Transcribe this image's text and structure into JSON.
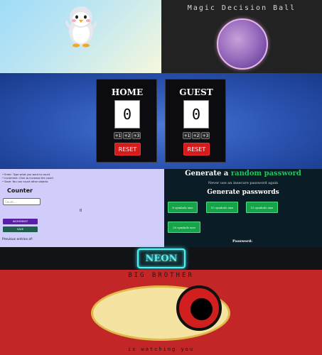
{
  "magic": {
    "title": "Magic Decision Ball"
  },
  "scoreboard": {
    "home": {
      "name": "HOME",
      "score": "0"
    },
    "guest": {
      "name": "GUEST",
      "score": "0"
    },
    "increments": [
      "+1",
      "+2",
      "+3"
    ],
    "reset_label": "RESET",
    "colors": {
      "reset": "#d41c1c",
      "panel": "#0c0c10"
    }
  },
  "counter": {
    "instructions": [
      "Enter: Type what you want to count",
      "Increment: Click to increase the count",
      "Save: You can count other objects"
    ],
    "title": "Counter",
    "input_placeholder": "Count...",
    "value": "0",
    "increment_label": "INCREMENT",
    "save_label": "SAVE",
    "previous_label": "Previous entries of:"
  },
  "password": {
    "title_prefix": "Generate a",
    "title_accent": "random password",
    "subtitle": "Never use an insecure password again",
    "heading": "Generate passwords",
    "buttons": [
      "8 symbols size",
      "10 symbols size",
      "15 symbols size",
      "20 symbols size"
    ],
    "password_label": "Password:",
    "colors": {
      "accent": "#22c55e",
      "button": "#16a34a"
    }
  },
  "neon": {
    "label": "NEON",
    "color": "#4ff2f2"
  },
  "bigbrother": {
    "title": "BIG BROTHER",
    "caption": "is watching you"
  }
}
